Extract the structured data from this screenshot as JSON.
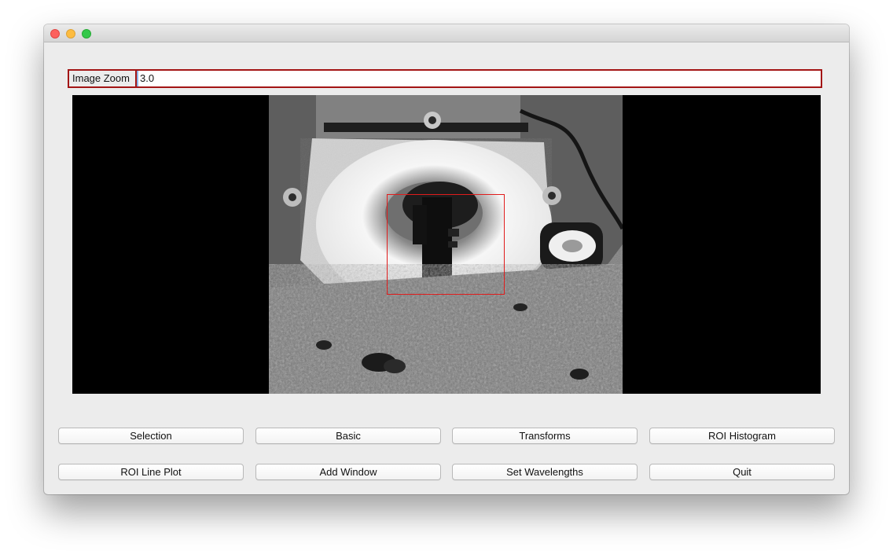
{
  "window": {
    "controls": [
      "close-icon",
      "minimize-icon",
      "zoom-icon"
    ]
  },
  "zoom": {
    "label": "Image Zoom",
    "value": "3.0"
  },
  "viewer": {
    "image": "rover instrument close-up (grayscale)",
    "roi_color": "#e01c1c"
  },
  "buttons": {
    "row1": [
      "Selection",
      "Basic",
      "Transforms",
      "ROI Histogram"
    ],
    "row2": [
      "ROI Line Plot",
      "Add Window",
      "Set Wavelengths",
      "Quit"
    ]
  },
  "colors": {
    "highlight_border": "#a31515",
    "window_bg": "#ececec"
  }
}
